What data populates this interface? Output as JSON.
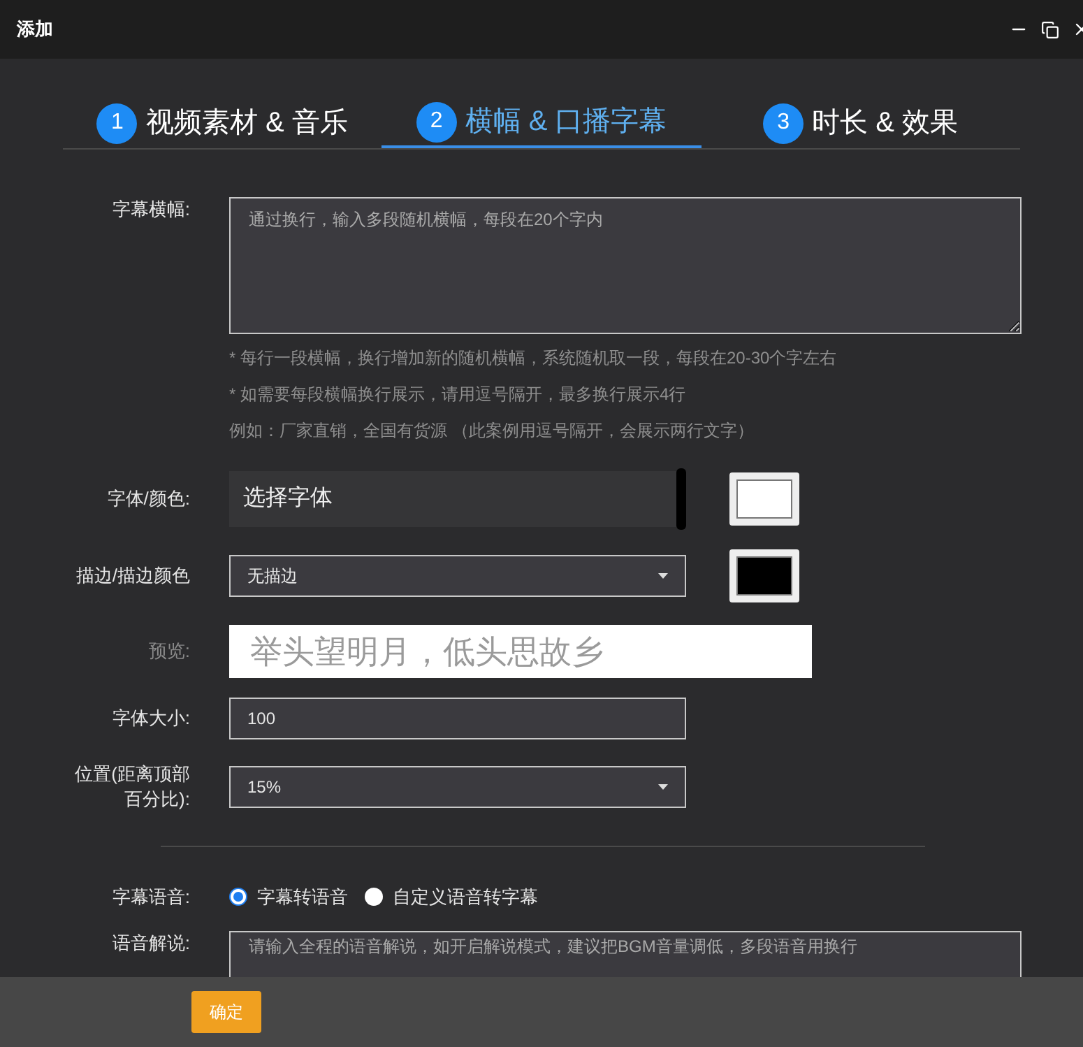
{
  "window": {
    "title": "添加"
  },
  "steps": [
    {
      "number": "1",
      "label": "视频素材 & 音乐",
      "selected": false
    },
    {
      "number": "2",
      "label": "横幅 & 口播字幕",
      "selected": true
    },
    {
      "number": "3",
      "label": "时长 & 效果",
      "selected": false
    }
  ],
  "form": [
    {
      "kind": "textarea",
      "label": "字幕横幅:",
      "placeholder": "通过换行，输入多段随机横幅，每段在20个字内",
      "hints": [
        "* 每行一段横幅，换行增加新的随机横幅，系统随机取一段，每段在20-30个字左右",
        "* 如需要每段横幅换行展示，请用逗号隔开，最多换行展示4行",
        "例如：厂家直销，全国有货源 （此案例用逗号隔开，会展示两行文字）"
      ]
    },
    {
      "kind": "font",
      "label": "字体/颜色:",
      "value": "选择字体",
      "color": "#ffffff"
    },
    {
      "kind": "select",
      "label": "描边/描边颜色",
      "value": "无描边",
      "color": "#000000"
    },
    {
      "kind": "preview",
      "label": "预览:",
      "value": "举头望明月，低头思故乡"
    },
    {
      "kind": "input",
      "label": "字体大小:",
      "value": "100"
    },
    {
      "kind": "select",
      "label": "位置(距离顶部百分比):",
      "value": "15%"
    },
    {
      "kind": "divider"
    },
    {
      "kind": "radio",
      "label": "字幕语音:",
      "options": [
        {
          "label": "字幕转语音",
          "selected": true
        },
        {
          "label": "自定义语音转字幕",
          "selected": false
        }
      ]
    },
    {
      "kind": "cut",
      "label": "语音解说:",
      "placeholder": "请输入全程的语音解说，如开启解说模式，建议把BGM音量调低，多段语音用换行"
    }
  ],
  "footer": {
    "button": "确定"
  }
}
